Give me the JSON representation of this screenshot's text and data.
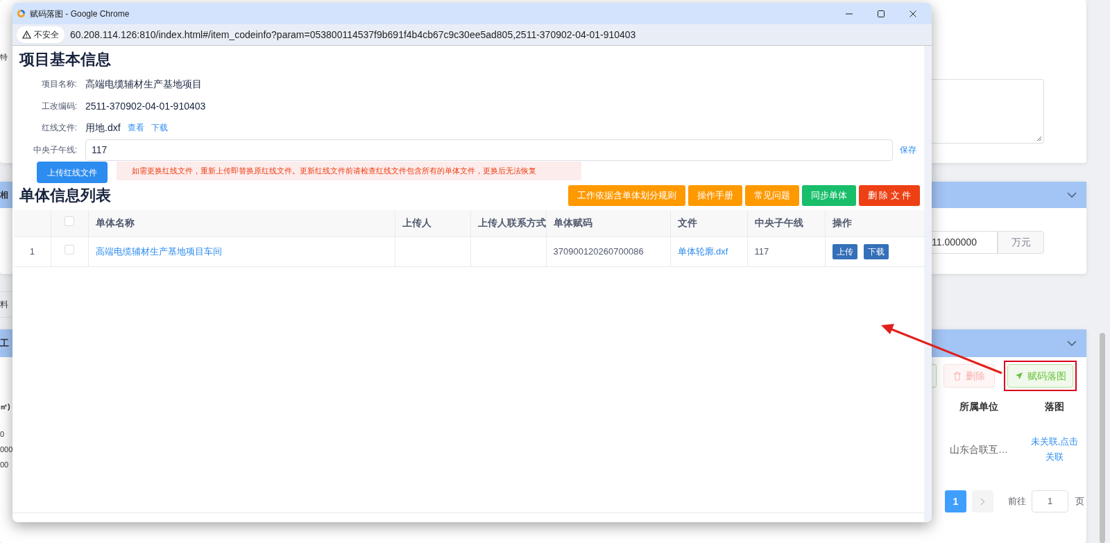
{
  "background": {
    "notes_card": {
      "left_text": "特"
    },
    "amount_card": {
      "header_left": "相",
      "amount_value": "11.000000",
      "amount_unit": "万元"
    },
    "divider_label": "料",
    "buildings_card": {
      "header_left": "工",
      "toolbar": [
        {
          "kind": "partial"
        },
        {
          "kind": "delete",
          "label": "删除",
          "disabled": true
        },
        {
          "kind": "map",
          "label": "赋码落图",
          "disabled": false,
          "highlighted": true
        }
      ],
      "left_column_head": "㎡)",
      "left_values": [
        "0",
        "000",
        "00"
      ],
      "columns": [
        "所属单位",
        "落图"
      ],
      "row": {
        "unit": "山东合联互…",
        "map_link": "未关联,点击关联"
      },
      "pagination": {
        "pages": [
          {
            "label": "1",
            "selected": true
          }
        ],
        "next_disabled": true,
        "goto_label": "前往",
        "goto_value": "1",
        "goto_suffix": "页"
      }
    }
  },
  "browser_window": {
    "title": "赋码落图 - Google Chrome",
    "security_label": "不安全",
    "url": "60.208.114.126:810/index.html#/item_codeinfo?param=053800114537f9b691f4b4cb67c9c30ee5ad805,2511-370902-04-01-910403"
  },
  "project_info": {
    "heading": "项目基本信息",
    "fields": [
      {
        "label": "项目名称:",
        "value": "高端电缆辅材生产基地项目"
      },
      {
        "label": "工改编码:",
        "value": "2511-370902-04-01-910403"
      }
    ],
    "redline_file": {
      "label": "红线文件:",
      "value": "用地.dxf",
      "links": [
        "查看",
        "下载"
      ]
    },
    "meridian": {
      "label": "中央子午线:",
      "value": "117",
      "save_link": "保存"
    },
    "upload_button": "上传红线文件",
    "warning": "如需更换红线文件，重新上传即替换原红线文件。更新红线文件前请检查红线文件包含所有的单体文件，更换后无法恢复"
  },
  "units": {
    "heading": "单体信息列表",
    "buttons": [
      {
        "label": "工作依据含单体划分规则",
        "kind": "warning"
      },
      {
        "label": "操作手册",
        "kind": "warning"
      },
      {
        "label": "常见问题",
        "kind": "warning"
      },
      {
        "label": "同步单体",
        "kind": "success"
      },
      {
        "label": "删 除 文 件",
        "kind": "danger"
      }
    ],
    "table": {
      "header_checked": false,
      "columns": [
        "单体名称",
        "上传人",
        "上传人联系方式",
        "单体赋码",
        "文件",
        "中央子午线",
        "操作"
      ],
      "rows": [
        {
          "index": "1",
          "checked": false,
          "name": "高端电缆辅材生产基地项目车间",
          "uploader": "",
          "contact": "",
          "code": "370900120260700086",
          "file": "单体轮廓.dxf",
          "meridian": "117",
          "actions": [
            "上传",
            "下载"
          ]
        }
      ]
    }
  }
}
